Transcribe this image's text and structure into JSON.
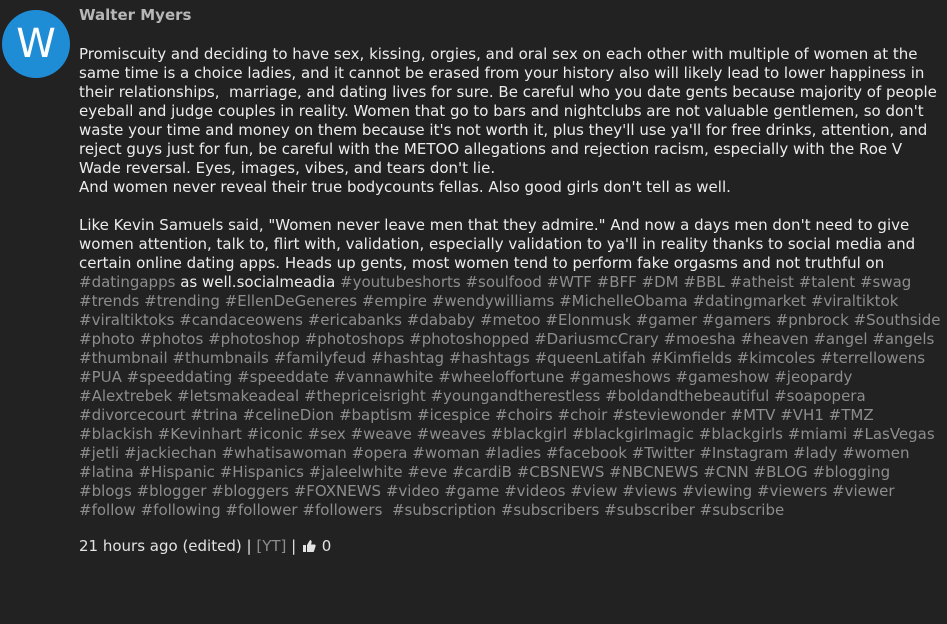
{
  "comment": {
    "avatar_letter": "W",
    "avatar_color": "#1f8dd6",
    "author": "Walter Myers",
    "paragraph1": "Promiscuity and deciding to have sex, kissing, orgies, and oral sex on each other with multiple of women at the same time is a choice ladies, and it cannot be erased from your history also will likely lead to lower happiness in their relationships,  marriage, and dating lives for sure. Be careful who you date gents because majority of people eyeball and judge couples in reality. Women that go to bars and nightclubs are not valuable gentlemen, so don't  waste your time and money on them because it's not worth it, plus they'll use ya'll for free drinks, attention, and reject guys just for fun, be careful with the METOO allegations and rejection racism, especially with the Roe V Wade reversal. Eyes, images, vibes, and tears don't lie.",
    "paragraph2": "And women never reveal their true bodycounts fellas. Also good girls don't tell as well.",
    "paragraph3_lead": "Like Kevin Samuels said, \"Women never leave men that they admire.\" And now a days men don't need to give women attention, talk to, flirt with, validation, especially validation to ya'll in reality thanks to social media and certain online dating apps. Heads up gents, most women tend to perform fake orgasms and not truthful on",
    "tag_first": "#datingapps",
    "paragraph3_mid": "as well.socialmeadia",
    "hashtags": [
      "#youtubeshorts",
      "#soulfood",
      "#WTF",
      "#BFF",
      "#DM",
      "#BBL",
      "#atheist",
      "#talent",
      "#swag",
      "#trends",
      "#trending",
      "#EllenDeGeneres",
      "#empire",
      "#wendywilliams",
      "#MichelleObama",
      "#datingmarket",
      "#viraltiktok",
      "#viraltiktoks",
      "#candaceowens",
      "#ericabanks",
      "#dababy",
      "#metoo",
      "#Elonmusk",
      "#gamer",
      "#gamers",
      "#pnbrock",
      "#Southside",
      "#photo",
      "#photos",
      "#photoshop",
      "#photoshops",
      "#photoshopped",
      "#DariusmcCrary",
      "#moesha",
      "#heaven",
      "#angel",
      "#angels",
      "#thumbnail",
      "#thumbnails",
      "#familyfeud",
      "#hashtag",
      "#hashtags",
      "#queenLatifah",
      "#Kimfields",
      "#kimcoles",
      "#terrellowens",
      "#PUA",
      "#speeddating",
      "#speeddate",
      "#vannawhite",
      "#wheeloffortune",
      "#gameshows",
      "#gameshow",
      "#jeopardy",
      "#Alextrebek",
      "#letsmakeadeal",
      "#thepriceisright",
      "#youngandtherestless",
      "#boldandthebeautiful",
      "#soapopera",
      "#divorcecourt",
      "#trina",
      "#celineDion",
      "#baptism",
      "#icespice",
      "#choirs",
      "#choir",
      "#steviewonder",
      "#MTV",
      "#VH1",
      "#TMZ",
      "#blackish",
      "#Kevinhart",
      "#iconic",
      "#sex",
      "#weave",
      "#weaves",
      "#blackgirl",
      "#blackgirlmagic",
      "#blackgirls",
      "#miami",
      "#LasVegas",
      "#jetli",
      "#jackiechan",
      "#whatisawoman",
      "#opera",
      "#woman",
      "#ladies",
      "#facebook",
      "#Twitter",
      "#Instagram",
      "#lady",
      "#women",
      "#latina",
      "#Hispanic",
      "#Hispanics",
      "#jaleelwhite",
      "#eve",
      "#cardiB",
      "#CBSNEWS",
      "#NBCNEWS",
      "#CNN",
      "#BLOG",
      "#blogging",
      "#blogs",
      "#blogger",
      "#bloggers",
      "#FOXNEWS",
      "#video",
      "#game",
      "#videos",
      "#view",
      "#views",
      "#viewing",
      "#viewers",
      "#viewer",
      "#follow",
      "#following",
      "#follower",
      "#followers",
      " #subscription",
      "#subscribers",
      "#subscriber",
      "#subscribe"
    ],
    "timestamp": "21 hours ago (edited)",
    "separator": "|",
    "yt_label": "[YT]",
    "like_icon": "thumbs-up",
    "like_count": "0"
  }
}
